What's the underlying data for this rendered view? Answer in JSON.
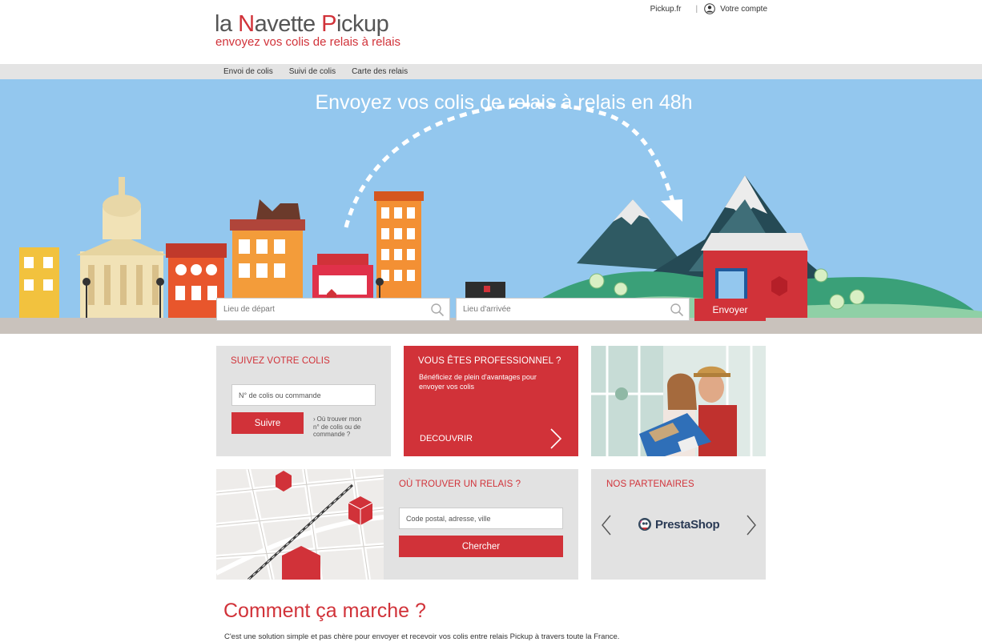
{
  "brand": {
    "title_parts": [
      "la ",
      "N",
      "avette ",
      "P",
      "ickup"
    ],
    "tagline": "envoyez vos colis de relais à relais"
  },
  "top_links": {
    "pickup": "Pickup.fr",
    "separator": "|",
    "account": "Votre compte"
  },
  "nav": {
    "items": [
      "Envoi de colis",
      "Suivi de colis",
      "Carte des relais"
    ]
  },
  "hero": {
    "title": "Envoyez vos colis de relais à relais en 48h",
    "departure_placeholder": "Lieu de départ",
    "arrival_placeholder": "Lieu d'arrivée",
    "submit_label": "Envoyer"
  },
  "track_card": {
    "title": "SUIVEZ VOTRE COLIS",
    "input_placeholder": "N° de colis ou commande",
    "button_label": "Suivre",
    "help_link_chevron": "›",
    "help_link": "Où trouver mon n° de colis ou de commande ?"
  },
  "pro_card": {
    "title": "VOUS ÊTES PROFESSIONNEL ?",
    "description": "Bénéficiez de plein d'avantages pour envoyer vos colis",
    "cta": "DECOUVRIR"
  },
  "relais_card": {
    "title": "OÙ TROUVER UN RELAIS ?",
    "input_placeholder": "Code postal, adresse, ville",
    "button_label": "Chercher"
  },
  "partners_card": {
    "title": "NOS PARTENAIRES",
    "partner_name": "PrestaShop"
  },
  "how_it_works": {
    "title": "Comment ça marche ?",
    "description": "C'est une solution simple et pas chère pour envoyer et recevoir vos colis entre relais Pickup à travers toute la France."
  },
  "colors": {
    "brand_red": "#d13239",
    "sky": "#93c7ee",
    "card_grey": "#e2e2e2",
    "nav_grey": "#e4e4e4"
  },
  "icons": [
    "user-icon",
    "search-icon",
    "chevron-right-icon",
    "chevron-left-icon",
    "prestashop-logo-icon"
  ]
}
